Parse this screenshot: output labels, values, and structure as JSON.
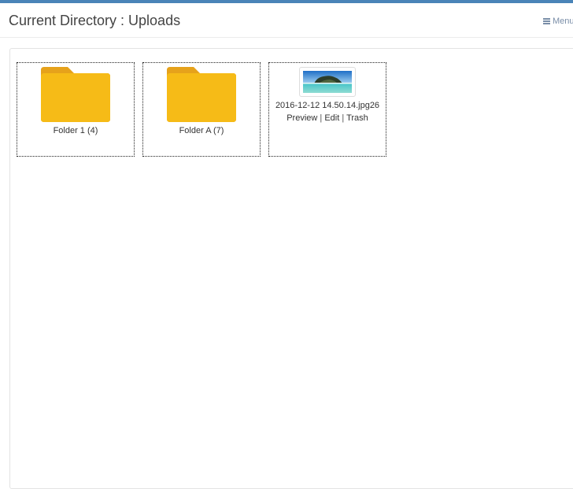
{
  "header": {
    "title": "Current Directory : Uploads",
    "menu_label": "Menu",
    "menu_icon": "bars-icon"
  },
  "colors": {
    "accent_bar": "#4a84b8",
    "folder": "#f6bb17",
    "folder_tab": "#e6a21b"
  },
  "items": [
    {
      "type": "folder",
      "icon": "folder-icon",
      "label": "Folder 1 (4)"
    },
    {
      "type": "folder",
      "icon": "folder-icon",
      "label": "Folder A (7)"
    },
    {
      "type": "file",
      "icon": "image-thumbnail",
      "name": "2016-12-12 14.50.14.jpg26",
      "actions": {
        "preview": "Preview",
        "separator": "|",
        "edit": "Edit",
        "trash": "Trash"
      }
    }
  ]
}
